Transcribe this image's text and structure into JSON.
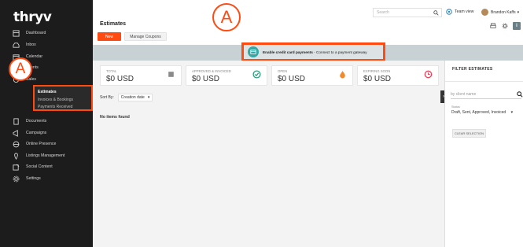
{
  "app": {
    "logo": "thryv"
  },
  "sidebar": {
    "items": [
      {
        "label": "Dashboard",
        "icon": "dashboard-icon"
      },
      {
        "label": "Inbox",
        "icon": "inbox-icon"
      },
      {
        "label": "Calendar",
        "icon": "calendar-icon"
      },
      {
        "label": "Clients",
        "icon": "clients-icon"
      },
      {
        "label": "Sales",
        "icon": "sales-icon"
      },
      {
        "label": "Documents",
        "icon": "documents-icon"
      },
      {
        "label": "Campaigns",
        "icon": "campaigns-icon"
      },
      {
        "label": "Online Presence",
        "icon": "globe-icon"
      },
      {
        "label": "Listings Management",
        "icon": "listings-icon"
      },
      {
        "label": "Social Content",
        "icon": "social-icon"
      },
      {
        "label": "Settings",
        "icon": "gear-icon"
      }
    ],
    "sales_sub": [
      "Estimates",
      "Invoices & Bookings",
      "Payments Received"
    ]
  },
  "callouts": {
    "sidebar_badge": "A",
    "banner_badge": "A"
  },
  "topbar": {
    "search_placeholder": "Search",
    "team_view": "Team view",
    "user_name": "Brandon Kaffs"
  },
  "page": {
    "title": "Estimates",
    "new_button": "New",
    "coupons_button": "Manage Coupons"
  },
  "banner": {
    "bold_text": "Enable credit card payments",
    "rest_text": " - Connect to a payment gateway"
  },
  "cards": [
    {
      "label": "TOTAL",
      "value": "$0 USD",
      "icon": "coins-icon",
      "color": "#8a8a8a"
    },
    {
      "label": "APPROVED & INVOICED",
      "value": "$0 USD",
      "icon": "check-doc-icon",
      "color": "#2e9d7e"
    },
    {
      "label": "OPEN",
      "value": "$0 USD",
      "icon": "fire-icon",
      "color": "#f08a2b"
    },
    {
      "label": "EXPIRING SOON",
      "value": "$0 USD",
      "icon": "clock-icon",
      "color": "#e8455a"
    }
  ],
  "sort": {
    "label": "Sort By:",
    "value": "Creation date"
  },
  "list": {
    "empty_text": "No items found"
  },
  "filter": {
    "title": "FILTER ESTIMATES",
    "client_placeholder": "by client name",
    "status_label": "Status",
    "status_value": "Draft, Sent, Approved, Invoiced",
    "clear_button": "CLEAR SELECTION"
  },
  "colors": {
    "accent": "#ff4b12",
    "sidebar_bg": "#1c1c1c",
    "banner_bg": "#c8d1d3",
    "banner_icon": "#33a8a5"
  }
}
